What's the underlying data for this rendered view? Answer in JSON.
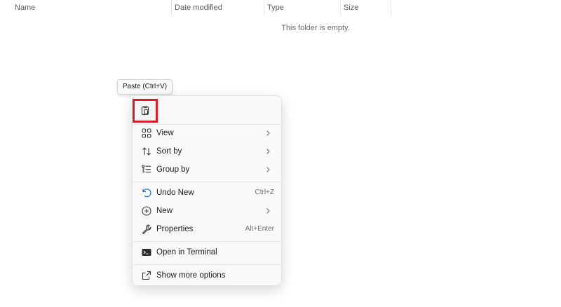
{
  "columns": {
    "name": "Name",
    "date_modified": "Date modified",
    "type": "Type",
    "size": "Size"
  },
  "folder": {
    "empty_message": "This folder is empty."
  },
  "tooltip": {
    "text": "Paste (Ctrl+V)"
  },
  "context_menu": {
    "quick_actions": [
      {
        "icon": "paste-icon",
        "tooltip": "Paste (Ctrl+V)",
        "highlighted": true
      }
    ],
    "items": [
      {
        "label": "View",
        "icon": "grid-view-icon",
        "submenu": true
      },
      {
        "label": "Sort by",
        "icon": "sort-icon",
        "submenu": true
      },
      {
        "label": "Group by",
        "icon": "group-by-icon",
        "submenu": true
      },
      {
        "label": "Undo New",
        "icon": "undo-icon",
        "shortcut": "Ctrl+Z"
      },
      {
        "label": "New",
        "icon": "new-plus-icon",
        "submenu": true
      },
      {
        "label": "Properties",
        "icon": "wrench-icon",
        "shortcut": "Alt+Enter"
      },
      {
        "label": "Open in Terminal",
        "icon": "terminal-icon"
      },
      {
        "label": "Show more options",
        "icon": "share-icon"
      }
    ]
  },
  "colors": {
    "highlight_border": "#d0202e",
    "undo_icon": "#2a6fb8",
    "menu_background": "#f9f9f9"
  }
}
